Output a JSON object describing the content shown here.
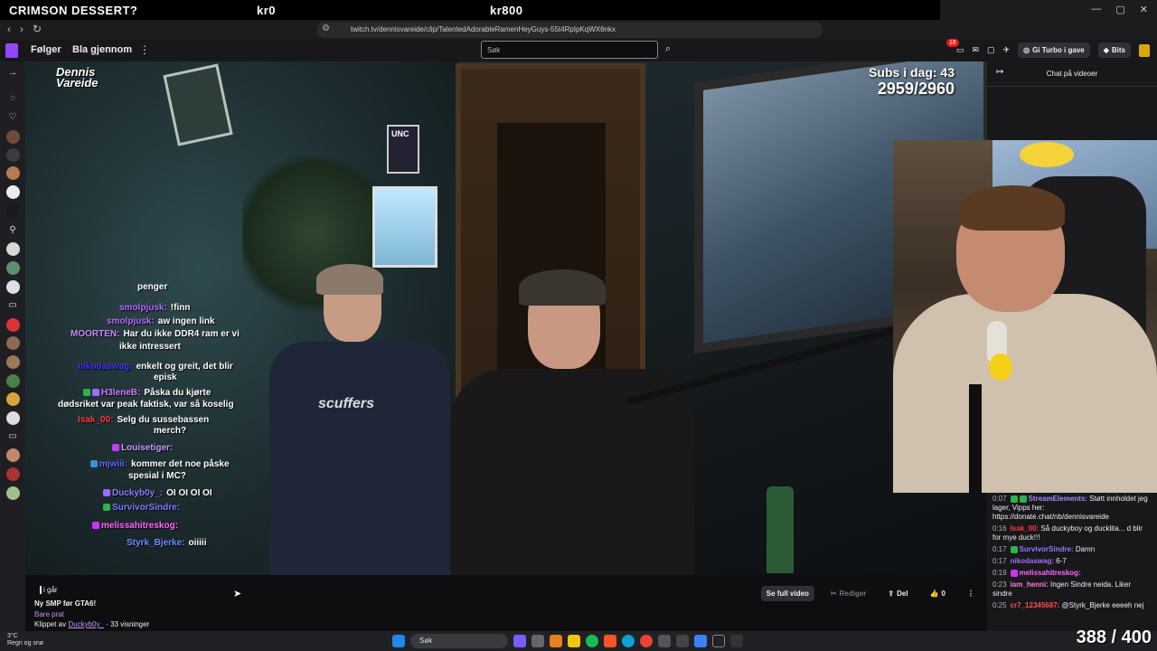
{
  "overlay": {
    "title": "CRIMSON DESSERT?",
    "price1": "kr0",
    "price2": "kr800"
  },
  "browser": {
    "url": "twitch.tv/dennisvareide/clip/TalentedAdorableRamenHeyGuys-55t4RpIpKqWX6nkx"
  },
  "twitch_nav": {
    "following": "Følger",
    "browse": "Bla gjennom",
    "search_placeholder": "Søk",
    "notif_count": "18",
    "turbo": "Gi Turbo i gave",
    "bits": "Bits"
  },
  "stream": {
    "logo_line1": "Dennis",
    "logo_line2": "Vareide",
    "subs_label": "Subs i dag: 43",
    "subs_goal": "2959/2960",
    "poster_text": "UNC",
    "hoodie_logo": "scuffers"
  },
  "overlay_chat": [
    {
      "user": "",
      "text": "penger",
      "color": "#ffffff"
    },
    {
      "user": "smolpjusk:",
      "text": "!finn",
      "color": "#b46cff"
    },
    {
      "user": "smolpjusk:",
      "text": "aw ingen link",
      "color": "#b46cff"
    },
    {
      "user": "MOORTEN:",
      "text": "Har du ikke DDR4 ram er vi",
      "color": "#c98cff"
    },
    {
      "user": "",
      "text": "ikke intressert",
      "color": "#ffffff"
    },
    {
      "user": "nikodaswag:",
      "text": "enkelt og greit, det blir",
      "color": "#4b33ff"
    },
    {
      "user": "",
      "text": "episk",
      "color": "#ffffff"
    },
    {
      "user": "H3leneB:",
      "text": "Påska du kjørte",
      "color": "#d07bff"
    },
    {
      "user": "",
      "text": "dødsriket var peak faktisk, var så koselig",
      "color": "#ffffff"
    },
    {
      "user": "Isak_00:",
      "text": "Selg du sussebassen",
      "color": "#ff3b3b"
    },
    {
      "user": "",
      "text": "merch?",
      "color": "#ffffff"
    },
    {
      "user": "Louisetiger:",
      "text": "",
      "color": "#c69cff"
    },
    {
      "user": "mjwiii:",
      "text": "kommer det noe påske",
      "color": "#5a6bff"
    },
    {
      "user": "",
      "text": "spesial i MC?",
      "color": "#ffffff"
    },
    {
      "user": "Duckyb0y_:",
      "text": "OI OI OI OI",
      "color": "#8e7bff"
    },
    {
      "user": "SurvivorSindre:",
      "text": "",
      "color": "#7a7bff"
    },
    {
      "user": "melissahitreskog:",
      "text": "",
      "color": "#ff66ff"
    },
    {
      "user": "Styrk_Bjerke:",
      "text": "oiiiii",
      "color": "#6a8dff"
    }
  ],
  "chat_panel": {
    "title": "Chat på videoer",
    "messages": [
      {
        "ts": "0:07",
        "user": "StreamElements:",
        "text": "Støtt innholdet jeg lager, Vipps her: https://donate.chat/nb/dennisvareide",
        "color": "#a48cff"
      },
      {
        "ts": "0:16",
        "user": "Isak_00:",
        "text": "Så duckyboy og ducklita... d blir for mye duck!!!",
        "color": "#ff3b3b"
      },
      {
        "ts": "0:17",
        "user": "SurvivorSindre:",
        "text": "Damn",
        "color": "#8e7bff"
      },
      {
        "ts": "0:17",
        "user": "nikodaswag:",
        "text": "6-7",
        "color": "#a36cff"
      },
      {
        "ts": "0:19",
        "user": "melissahitreskog:",
        "text": "",
        "color": "#ff66ff"
      },
      {
        "ts": "0:23",
        "user": "iam_henni:",
        "text": "Ingen Sindre neida. Liker sindre",
        "color": "#ff7ad9"
      },
      {
        "ts": "0:25",
        "user": "cr7_12345687:",
        "text": "@Styrk_Bjerke eeeeh nej",
        "color": "#ff4d4d"
      }
    ]
  },
  "clip_info": {
    "when": "i går",
    "title": "Ny SMP før GTA6!",
    "category": "Bare prat",
    "clipped_by_label": "Klippet av",
    "clipper": "Duckyb0y_",
    "views": "· 33 visninger"
  },
  "actions": {
    "full_video": "Se full video",
    "edit": "Rediger",
    "share": "Del",
    "likes": "0"
  },
  "taskbar": {
    "weather_temp": "3°C",
    "weather_desc": "Regn og snø",
    "search": "Søk"
  },
  "counter": "388 / 400",
  "colors": {
    "twitch_purple": "#9147ff",
    "notif_red": "#e91916",
    "bits_gold": "#d8a900"
  }
}
